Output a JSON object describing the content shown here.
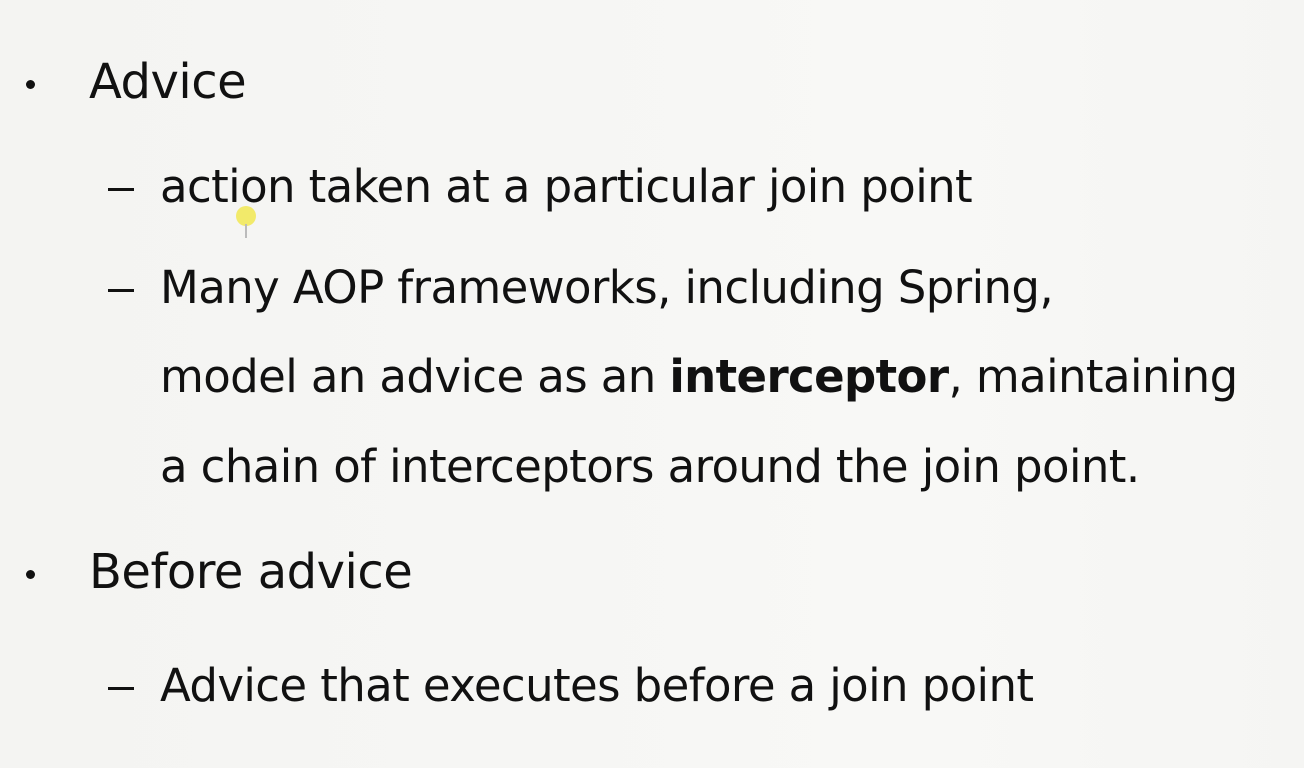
{
  "slide": {
    "items": [
      {
        "label": "Advice",
        "subitems": [
          {
            "text": "action taken at a particular join point"
          },
          {
            "line1": "Many AOP frameworks, including Spring,",
            "line2_pre": "model an advice as an ",
            "line2_bold": "interceptor",
            "line2_post": ", maintaining",
            "line3": "a chain of interceptors around the join point."
          }
        ]
      },
      {
        "label": "Before advice",
        "subitems": [
          {
            "text": "Advice that executes before a join point"
          }
        ]
      }
    ]
  },
  "colors": {
    "text": "#111111",
    "background": "#f6f6f4",
    "pointer_highlight": "#f0e63c"
  }
}
